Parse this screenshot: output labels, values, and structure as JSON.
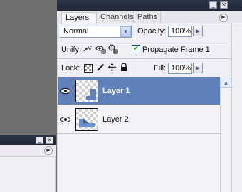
{
  "layers_panel": {
    "tabs": [
      "Layers",
      "Channels",
      "Paths"
    ],
    "title_buttons": {
      "minimize": "_",
      "close": "×"
    },
    "menu_glyph": "▶",
    "blend_mode": "Normal",
    "opacity_label": "Opacity:",
    "opacity_value": "100%",
    "unify_label": "Unify:",
    "propagate_label": "Propagate Frame 1",
    "propagate_checked": true,
    "lock_label": "Lock:",
    "fill_label": "Fill:",
    "fill_value": "100%",
    "layers": [
      {
        "name": "Layer 1",
        "visible": true,
        "selected": true
      },
      {
        "name": "Layer 2",
        "visible": true,
        "selected": false
      }
    ]
  },
  "left_panel": {
    "title_buttons": {
      "minimize": "_",
      "close": "×"
    },
    "menu_glyph": "▶"
  },
  "icons": {
    "dropdown": "▼",
    "flyout": "▶",
    "scroll_up": "▲",
    "checkmark": "✔",
    "eye": "eye-icon",
    "lock_all": "🔒"
  },
  "colors": {
    "selection": "#5f80b8",
    "titlebar": "#2d3649",
    "canvas": "#6f6f6f"
  }
}
